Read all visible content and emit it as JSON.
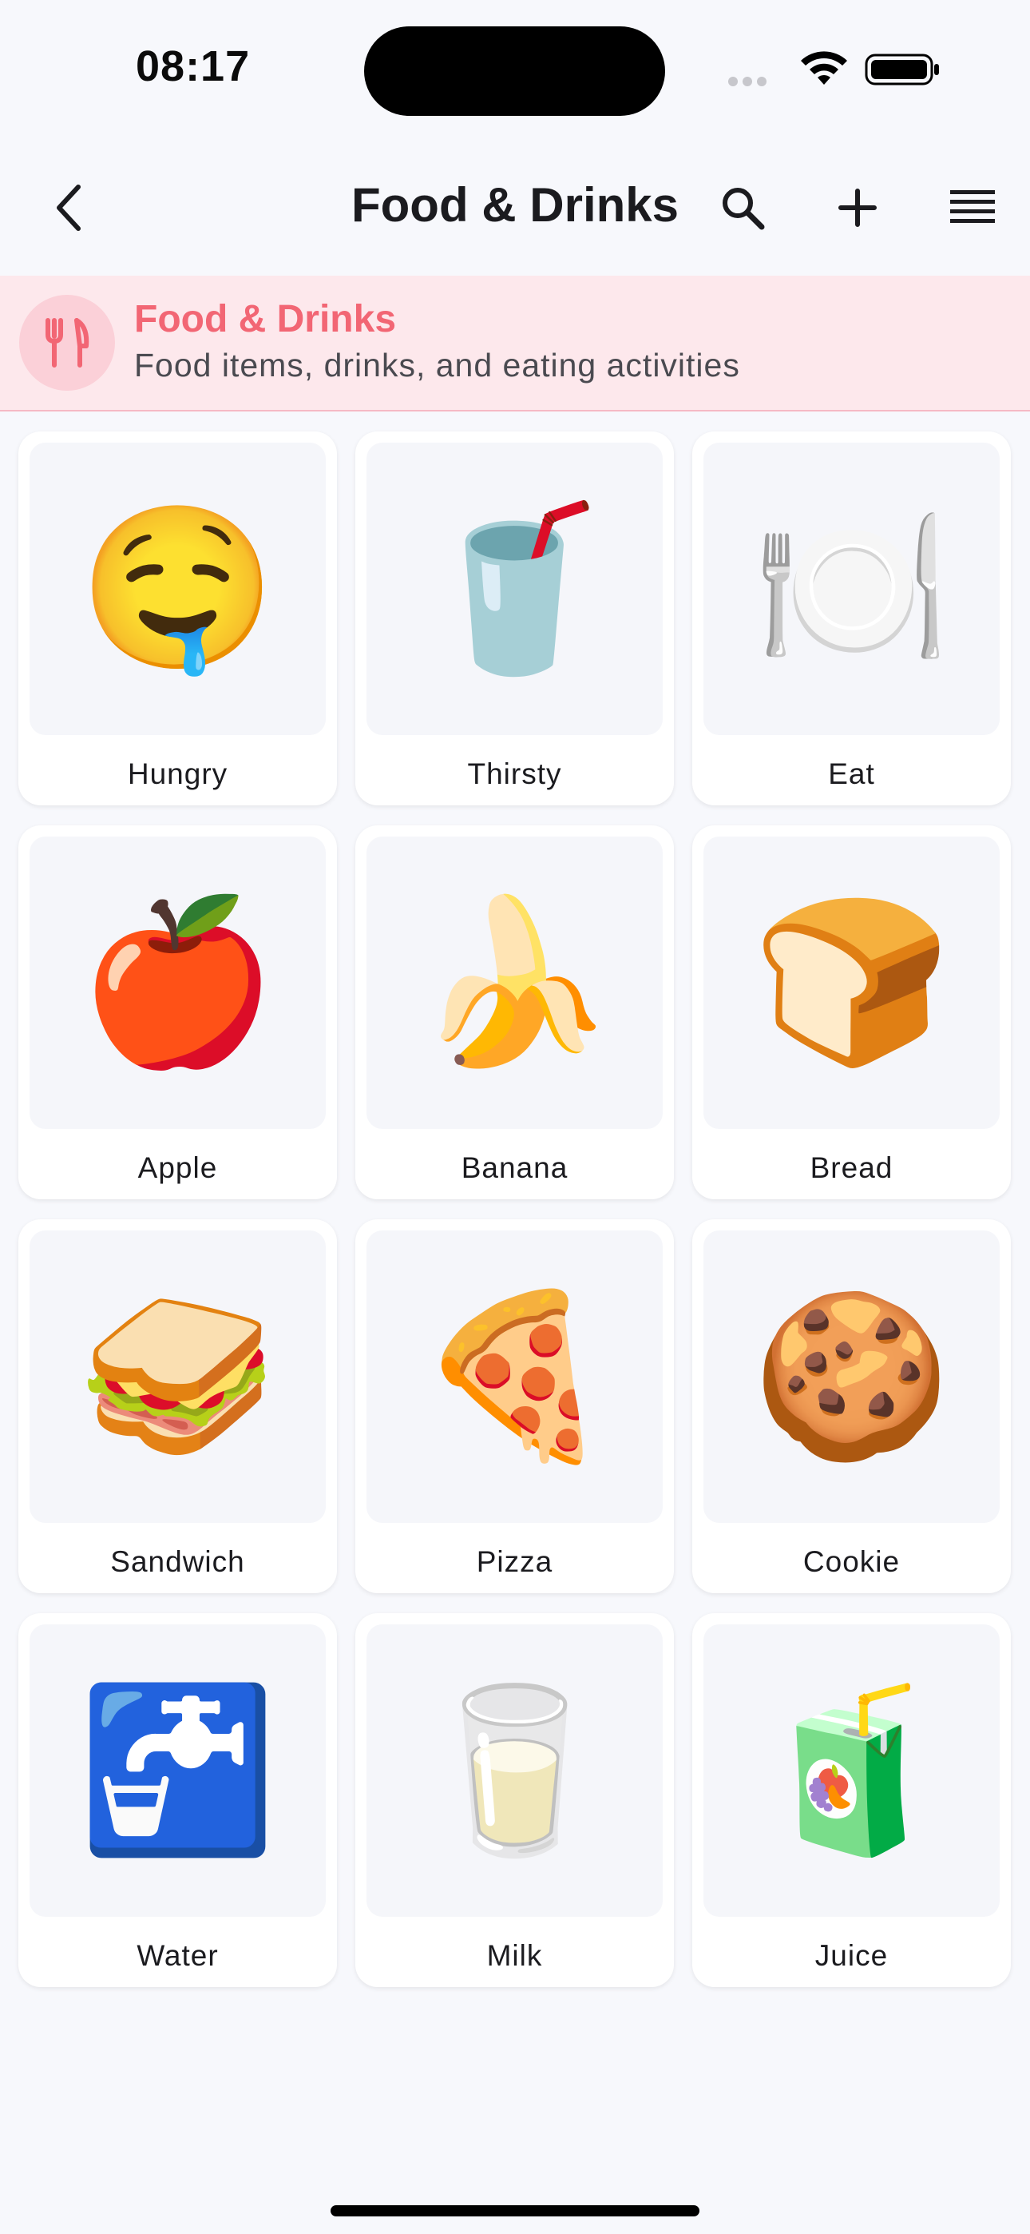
{
  "status_bar": {
    "time": "08:17"
  },
  "app_bar": {
    "title": "Food & Drinks",
    "icons": [
      "back-chevron-icon",
      "search-icon",
      "plus-icon",
      "menu-lines-icon"
    ]
  },
  "category": {
    "title": "Food & Drinks",
    "subtitle": "Food items, drinks, and eating activities",
    "icon": "fork-knife-icon",
    "accent_color": "#f26674",
    "background_color": "#fde8ec"
  },
  "tiles": [
    {
      "label": "Hungry",
      "emoji": "🤤",
      "icon": "drooling-face-icon"
    },
    {
      "label": "Thirsty",
      "emoji": "🥤",
      "icon": "cup-with-straw-icon"
    },
    {
      "label": "Eat",
      "emoji": "🍽️",
      "icon": "fork-knife-plate-icon"
    },
    {
      "label": "Apple",
      "emoji": "🍎",
      "icon": "apple-icon"
    },
    {
      "label": "Banana",
      "emoji": "🍌",
      "icon": "banana-icon"
    },
    {
      "label": "Bread",
      "emoji": "🍞",
      "icon": "bread-icon"
    },
    {
      "label": "Sandwich",
      "emoji": "🥪",
      "icon": "sandwich-icon"
    },
    {
      "label": "Pizza",
      "emoji": "🍕",
      "icon": "pizza-icon"
    },
    {
      "label": "Cookie",
      "emoji": "🍪",
      "icon": "cookie-icon"
    },
    {
      "label": "Water",
      "emoji": "🚰",
      "icon": "water-tap-icon"
    },
    {
      "label": "Milk",
      "emoji": "🥛",
      "icon": "milk-glass-icon"
    },
    {
      "label": "Juice",
      "emoji": "🧃",
      "icon": "juice-box-icon"
    }
  ]
}
